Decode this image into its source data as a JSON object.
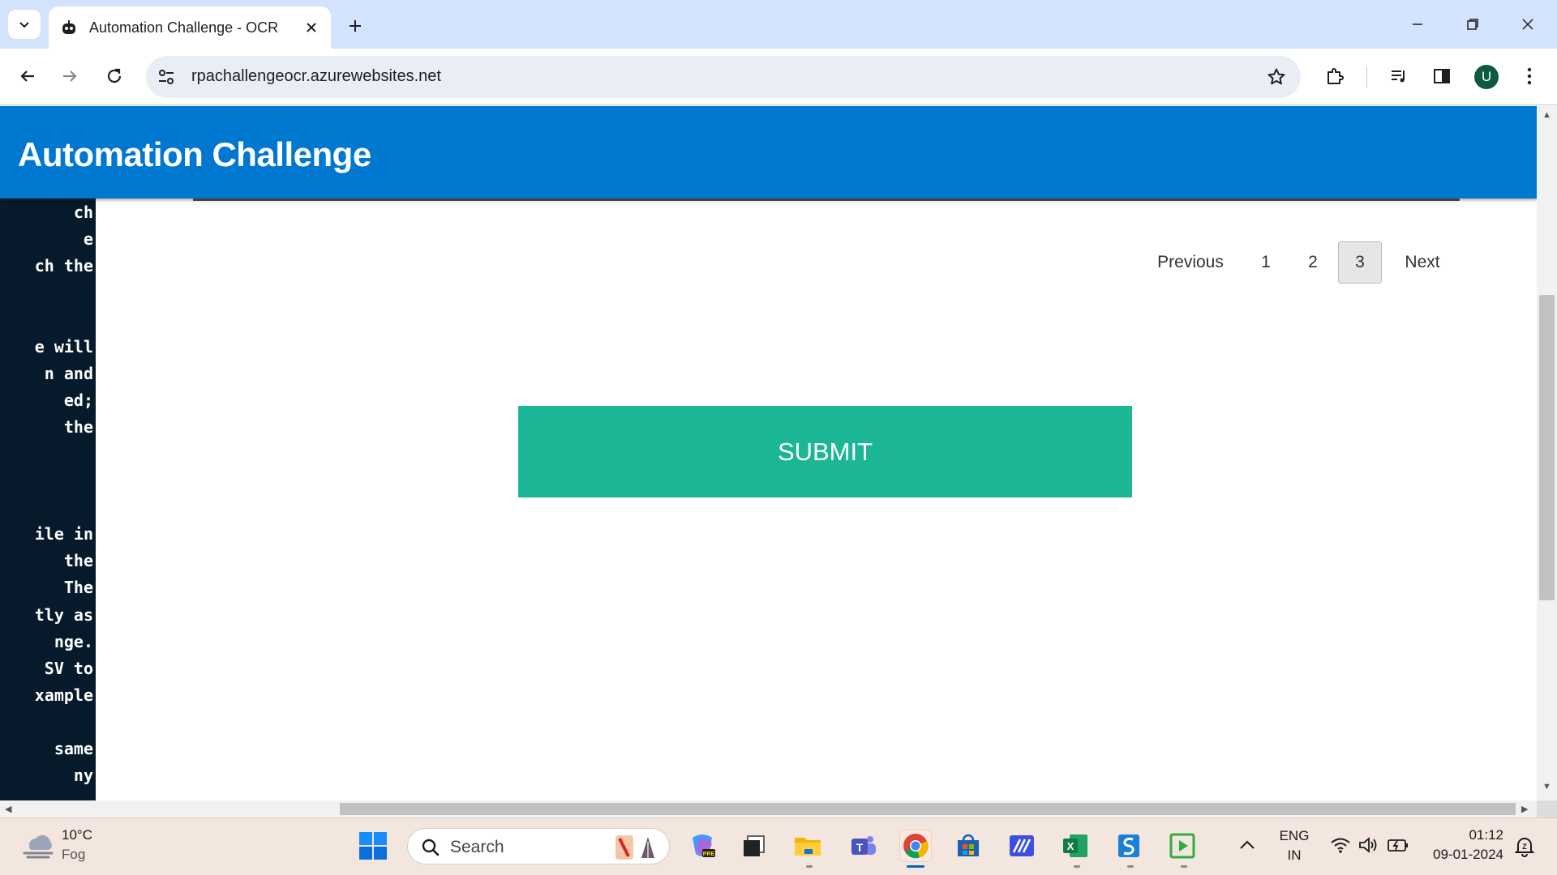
{
  "browser": {
    "tab_title": "Automation Challenge - OCR",
    "url": "rpachallengeocr.azurewebsites.net",
    "profile_initial": "U"
  },
  "page": {
    "header_title": "Automation Challenge",
    "side_panel_lines": [
      "ch",
      "e",
      "ch the",
      "",
      "",
      "e will",
      "n and",
      "ed;",
      " the",
      "",
      "",
      "",
      "ile in",
      " the",
      "The",
      "tly as",
      "nge.",
      "SV to",
      "xample",
      "",
      " same",
      "ny"
    ],
    "pagination": {
      "previous": "Previous",
      "pages": [
        "1",
        "2",
        "3"
      ],
      "active_page": "3",
      "next": "Next"
    },
    "submit_label": "SUBMIT"
  },
  "taskbar": {
    "weather_temp": "10°C",
    "weather_condition": "Fog",
    "search_placeholder": "Search",
    "language_line1": "ENG",
    "language_line2": "IN",
    "time": "01:12",
    "date": "09-01-2024"
  },
  "colors": {
    "header_blue": "#0078d0",
    "submit_green": "#1bb794",
    "side_panel": "#061a2b"
  }
}
